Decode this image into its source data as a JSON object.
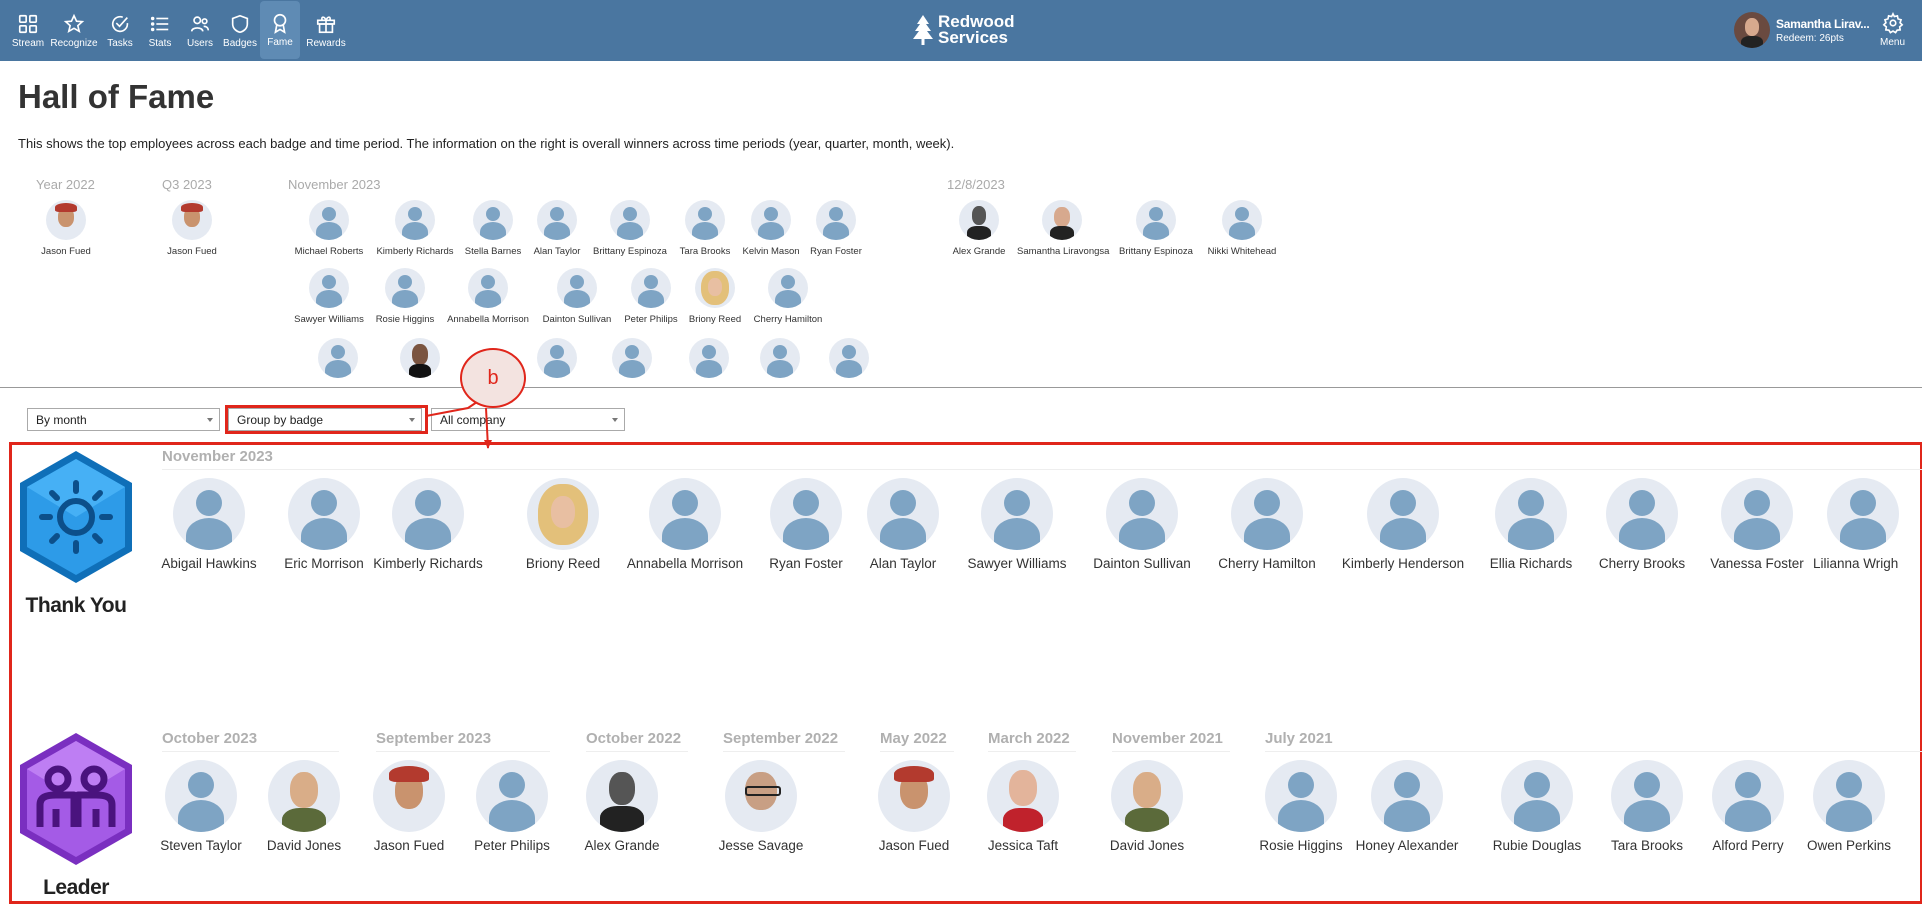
{
  "nav": [
    {
      "label": "Stream",
      "icon": "grid-icon"
    },
    {
      "label": "Recognize",
      "icon": "star-icon"
    },
    {
      "label": "Tasks",
      "icon": "check-circle-icon"
    },
    {
      "label": "Stats",
      "icon": "list-icon"
    },
    {
      "label": "Users",
      "icon": "users-icon"
    },
    {
      "label": "Badges",
      "icon": "shield-icon"
    },
    {
      "label": "Fame",
      "icon": "award-icon",
      "active": true
    },
    {
      "label": "Rewards",
      "icon": "gift-icon"
    }
  ],
  "brand": {
    "line1": "Redwood",
    "line2": "Services"
  },
  "user": {
    "name": "Samantha Lirav...",
    "redeem": "Redeem: 26pts"
  },
  "menu": {
    "label": "Menu"
  },
  "page": {
    "title": "Hall of Fame",
    "description": "This shows the top employees across each badge and time period. The information on the right is overall winners across time periods (year, quarter, month, week)."
  },
  "summary": {
    "year": {
      "label": "Year 2022",
      "people": [
        "Jason Fued"
      ]
    },
    "quarter": {
      "label": "Q3 2023",
      "people": [
        "Jason Fued"
      ]
    },
    "month": {
      "label": "November 2023",
      "row1": [
        "Michael Roberts",
        "Kimberly Richards",
        "Stella Barnes",
        "Alan Taylor",
        "Brittany Espinoza",
        "Tara Brooks",
        "Kelvin Mason",
        "Ryan Foster"
      ],
      "row2": [
        "Sawyer Williams",
        "Rosie Higgins",
        "Annabella Morrison",
        "Dainton Sullivan",
        "Peter Philips",
        "Briony Reed",
        "Cherry Hamilton"
      ]
    },
    "week": {
      "label": "12/8/2023",
      "people": [
        "Alex Grande",
        "Samantha Liravongsa",
        "Brittany Espinoza",
        "Nikki Whitehead"
      ]
    }
  },
  "filters": {
    "period": "By month",
    "grouping": "Group by badge",
    "scope": "All company"
  },
  "annotation": {
    "callout": "b",
    "color": "#e0261b"
  },
  "groups": [
    {
      "badge": "Thank You",
      "badge_color": "#1a86d6",
      "periods": [
        {
          "label": "November 2023",
          "people": [
            "Abigail Hawkins",
            "Eric Morrison",
            "Kimberly Richards",
            "Briony Reed",
            "Annabella Morrison",
            "Ryan Foster",
            "Alan Taylor",
            "Sawyer Williams",
            "Dainton Sullivan",
            "Cherry Hamilton",
            "Kimberly Henderson",
            "Ellia Richards",
            "Cherry Brooks",
            "Vanessa Foster",
            "Lilianna Wrigh"
          ]
        }
      ]
    },
    {
      "badge": "Leader",
      "badge_color": "#9b4fd6",
      "periods": [
        {
          "label": "October 2023",
          "people": [
            "Steven Taylor",
            "David Jones"
          ]
        },
        {
          "label": "September 2023",
          "people": [
            "Jason Fued",
            "Peter Philips"
          ]
        },
        {
          "label": "October 2022",
          "people": [
            "Alex Grande"
          ]
        },
        {
          "label": "September 2022",
          "people": [
            "Jesse Savage"
          ]
        },
        {
          "label": "May 2022",
          "people": [
            "Jason Fued"
          ]
        },
        {
          "label": "March 2022",
          "people": [
            "Jessica Taft"
          ]
        },
        {
          "label": "November 2021",
          "people": [
            "David Jones"
          ]
        },
        {
          "label": "July 2021",
          "people": [
            "Rosie Higgins",
            "Honey Alexander",
            "Rubie Douglas",
            "Tara Brooks",
            "Alford Perry",
            "Owen Perkins"
          ]
        }
      ]
    }
  ]
}
